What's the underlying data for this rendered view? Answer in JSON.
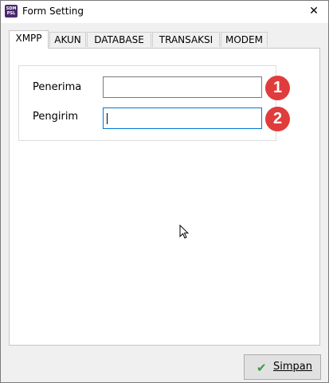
{
  "window": {
    "title": "Form Setting",
    "app_icon_text": "SDM PSL",
    "close_symbol": "✕"
  },
  "tabs": [
    {
      "label": "XMPP",
      "active": true
    },
    {
      "label": "AKUN"
    },
    {
      "label": "DATABASE"
    },
    {
      "label": "TRANSAKSI"
    },
    {
      "label": "MODEM"
    }
  ],
  "form": {
    "penerima_label": "Penerima",
    "penerima_value": "",
    "pengirim_label": "Pengirim",
    "pengirim_value": ""
  },
  "badges": [
    "1",
    "2"
  ],
  "footer": {
    "save_label": "Simpan",
    "save_icon": "check-icon"
  },
  "colors": {
    "badge": "#e03c3c",
    "focus_border": "#0078d7",
    "check": "#3a9a3a"
  }
}
